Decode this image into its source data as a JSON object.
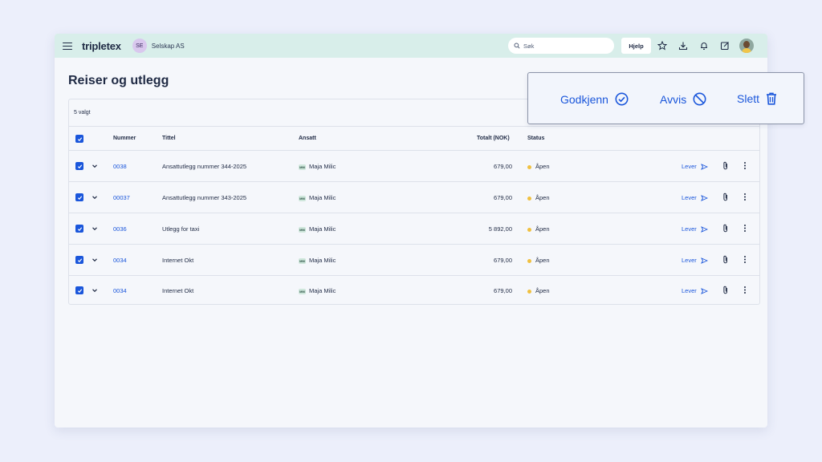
{
  "topbar": {
    "logo": "tripletex",
    "company_initials": "SE",
    "company_name": "Selskap AS",
    "search_placeholder": "Søk",
    "help_label": "Hjelp",
    "icons": [
      "star-icon",
      "download-icon",
      "bell-icon",
      "external-link-icon"
    ]
  },
  "page": {
    "title": "Reiser og utlegg"
  },
  "table": {
    "selected_count": "5 valgt",
    "columns": {
      "number": "Nummer",
      "title": "Tittel",
      "employee": "Ansatt",
      "total": "Totalt (NOK)",
      "status": "Status"
    },
    "rows": [
      {
        "number": "0038",
        "title": "Ansattutlegg nummer 344-2025",
        "employee_initials": "MM",
        "employee": "Maja Milic",
        "total": "679,00",
        "status": "Åpen",
        "action": "Lever"
      },
      {
        "number": "00037",
        "title": "Ansattutlegg nummer 343-2025",
        "employee_initials": "MM",
        "employee": "Maja Milic",
        "total": "679,00",
        "status": "Åpen",
        "action": "Lever"
      },
      {
        "number": "0036",
        "title": "Utlegg for taxi",
        "employee_initials": "MM",
        "employee": "Maja Milic",
        "total": "5 892,00",
        "status": "Åpen",
        "action": "Lever"
      },
      {
        "number": "0034",
        "title": "Internet Okt",
        "employee_initials": "MM",
        "employee": "Maja Milic",
        "total": "679,00",
        "status": "Åpen",
        "action": "Lever"
      },
      {
        "number": "0034",
        "title": "Internet Okt",
        "employee_initials": "MM",
        "employee": "Maja Milic",
        "total": "679,00",
        "status": "Åpen",
        "action": "Lever"
      }
    ]
  },
  "bulk_actions": {
    "approve_label": "Godkjenn",
    "reject_label": "Avvis",
    "delete_label": "Slett"
  },
  "colors": {
    "accent": "#1a56db",
    "topbar": "#d8eeea",
    "status_open": "#f0c040"
  }
}
